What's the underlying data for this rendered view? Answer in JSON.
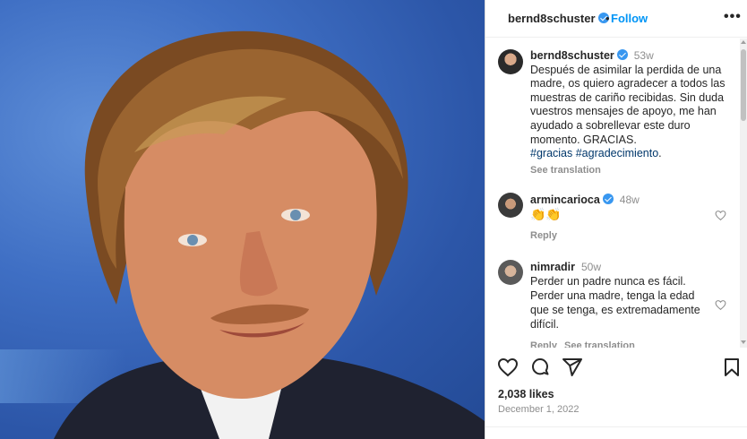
{
  "post": {
    "username": "bernd8schuster",
    "follow_label": "Follow",
    "dot": "•",
    "more_icon": "more-options-icon"
  },
  "caption": {
    "username": "bernd8schuster",
    "time": "53w",
    "text": "Después de asimilar la perdida de una madre, os quiero agradecer a todos las muestras de cariño recibidas. Sin duda vuestros mensajes de apoyo, me han ayudado a sobrellevar este duro momento. GRACIAS.",
    "hashtag1": "#gracias",
    "hashtag2": "#agradecimiento",
    "hashtag_end": ".",
    "see_translation": "See translation"
  },
  "comments": [
    {
      "username": "armincarioca",
      "verified": true,
      "time": "48w",
      "text": "👏👏",
      "reply": "Reply"
    },
    {
      "username": "nimradir",
      "verified": false,
      "time": "50w",
      "text": "Perder un padre nunca es fácil. Perder una madre, tenga la edad que se tenga, es extremadamente difícil.",
      "reply": "Reply",
      "see_translation": "See translation"
    }
  ],
  "stats": {
    "likes": "2,038 likes",
    "date": "December 1, 2022"
  },
  "icons": [
    "heart-icon",
    "comment-icon",
    "share-icon",
    "bookmark-icon",
    "verified-icon"
  ],
  "colors": {
    "accent": "#0095f6",
    "verified": "#3897f0",
    "muted": "#8e8e8e",
    "hashtag": "#00376b"
  }
}
